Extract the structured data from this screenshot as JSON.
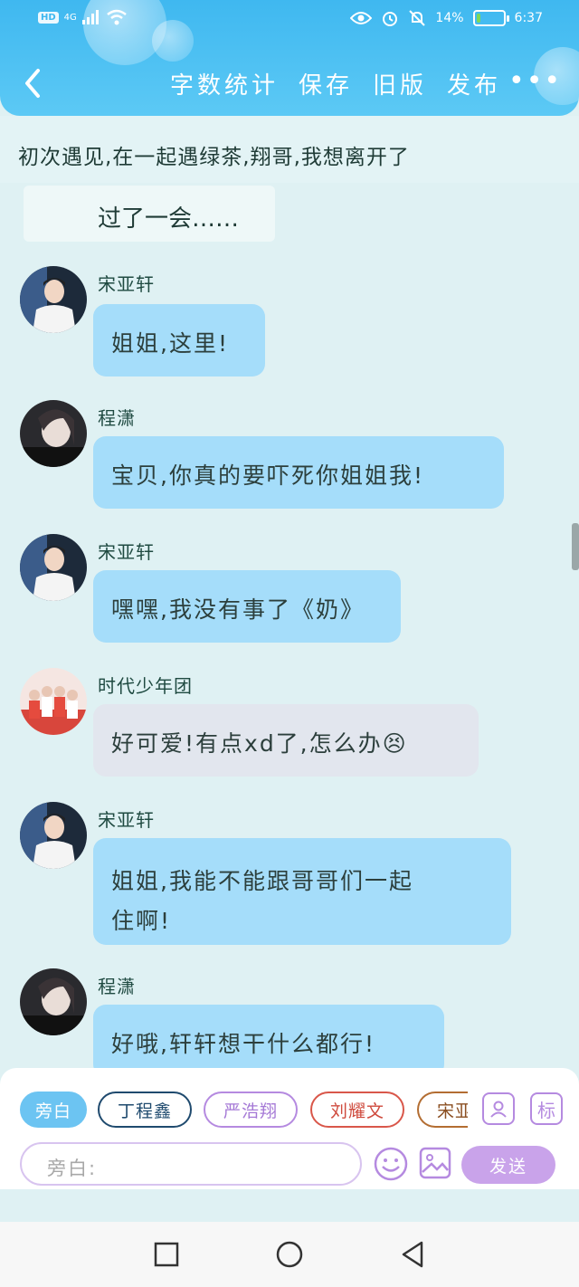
{
  "status_bar": {
    "network": "4G",
    "battery_text": "14%",
    "battery_level": 0.14,
    "time": "6:37"
  },
  "header": {
    "actions": [
      "字数统计",
      "保存",
      "旧版",
      "发布"
    ],
    "more": "•••"
  },
  "story": {
    "title_line": "初次遇见,在一起遇绿茶,翔哥,我想离开了",
    "narration": "过了一会……"
  },
  "messages": [
    {
      "sender": "宋亚轩",
      "text": "姐姐,这里!",
      "avatar": "boy-white-shirt"
    },
    {
      "sender": "程潇",
      "text": "宝贝,你真的要吓死你姐姐我!",
      "avatar": "girl-dark"
    },
    {
      "sender": "宋亚轩",
      "text": "嘿嘿,我没有事了《奶》",
      "avatar": "boy-white-shirt"
    },
    {
      "sender": "时代少年团",
      "text": "好可爱!有点xd了,怎么办😣",
      "avatar": "group-red"
    },
    {
      "sender": "宋亚轩",
      "text_line1": "姐姐,我能不能跟哥哥们一起",
      "text_line2": "住啊!",
      "avatar": "boy-white-shirt"
    },
    {
      "sender": "程潇",
      "text": "好哦,轩轩想干什么都行!",
      "avatar": "girl-dark"
    }
  ],
  "character_chips": [
    "旁白",
    "丁程鑫",
    "严浩翔",
    "刘耀文",
    "宋亚"
  ],
  "tools": {
    "person_icon": "person-icon",
    "tag_label": "标"
  },
  "input": {
    "placeholder": "旁白:",
    "send_label": "发送"
  },
  "colors": {
    "header": "#3fb8f0",
    "bubble_blue": "#a5ddfa",
    "bubble_grey": "#e2e6ee",
    "accent_purple": "#c9a3ea",
    "background": "#dff1f3"
  }
}
